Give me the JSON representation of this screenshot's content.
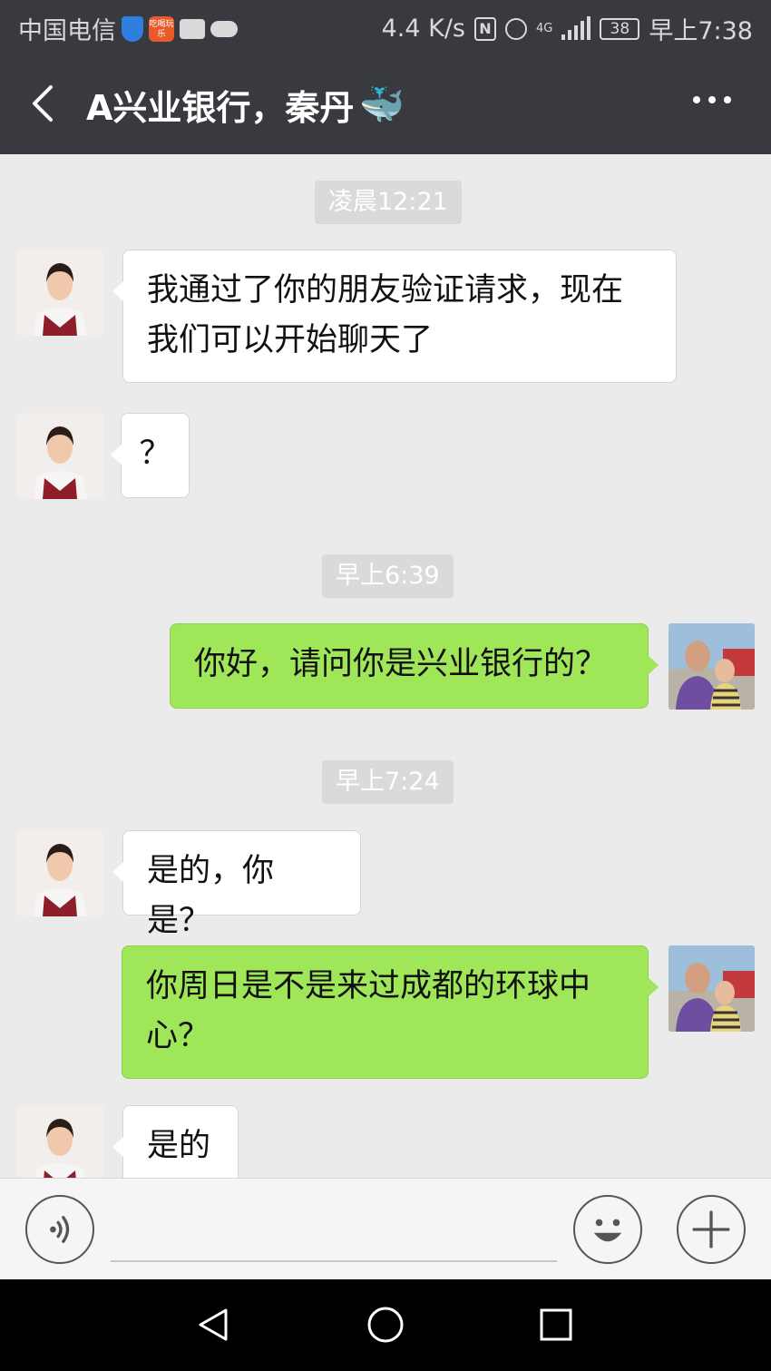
{
  "status_bar": {
    "carrier": "中国电信",
    "app_icon_text": "吃喝玩乐",
    "speed": "4.4 K/s",
    "network": "4G",
    "battery": "38",
    "time": "早上7:38",
    "icons": [
      "shield-icon",
      "app-icon",
      "briefcase-icon",
      "cloud-icon",
      "nfc-icon",
      "alarm-icon",
      "signal-icon",
      "battery-icon"
    ]
  },
  "header": {
    "back_icon": "chevron-left-icon",
    "title": "A兴业银行，秦丹",
    "title_emoji": "🐳",
    "more_icon": "more-icon"
  },
  "messages": [
    {
      "type": "time",
      "text": "凌晨12:21"
    },
    {
      "type": "in",
      "text": "我通过了你的朋友验证请求，现在我们可以开始聊天了"
    },
    {
      "type": "in",
      "text": "？"
    },
    {
      "type": "time",
      "text": "早上6:39"
    },
    {
      "type": "out",
      "text": "你好，请问你是兴业银行的？"
    },
    {
      "type": "time",
      "text": "早上7:24"
    },
    {
      "type": "in",
      "text": "是的，你是？"
    },
    {
      "type": "out",
      "text": "你周日是不是来过成都的环球中心？"
    },
    {
      "type": "in",
      "text": "是的"
    }
  ],
  "input_bar": {
    "voice_icon": "voice-icon",
    "emoji_icon": "emoji-icon",
    "plus_icon": "plus-icon",
    "value": ""
  },
  "nav_bar": {
    "icons": [
      "back-triangle-icon",
      "home-circle-icon",
      "recents-square-icon"
    ]
  }
}
